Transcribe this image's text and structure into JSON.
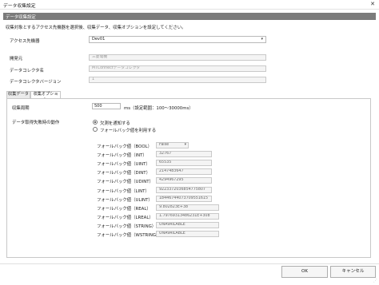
{
  "window": {
    "title": "データ収集設定",
    "close_glyph": "✕"
  },
  "header": {
    "title": "データ収集設定"
  },
  "description": "収集対象とするアクセス先機器を選択後、収集データ、収集オプションを設定してください。",
  "access": {
    "device_label": "アクセス先機器",
    "device_value": "Dev01",
    "vendor_label": "開発元",
    "vendor_value": "三菱電機",
    "collector_label": "データコレクタ名",
    "collector_value": "MTConnectデータコレクタ",
    "version_label": "データコレクタバージョン",
    "version_value": "1"
  },
  "tabs": [
    {
      "label": "収集データ",
      "active": false
    },
    {
      "label": "収集オプション",
      "active": true
    }
  ],
  "options": {
    "cycle_label": "収集周期",
    "cycle_value": "500",
    "cycle_unit": "ms（設定範囲：100～30000ms）",
    "failure_label": "データ取得失敗時の動作",
    "radio_notify": "欠測を通知する",
    "radio_fallback": "フォールバック値を利用する",
    "radio_selected": "notify",
    "fallback_rows": [
      {
        "label": "フォールバック値（BOOL）",
        "value": "False"
      },
      {
        "label": "フォールバック値（INT）",
        "value": "32767"
      },
      {
        "label": "フォールバック値（UINT）",
        "value": "65535"
      },
      {
        "label": "フォールバック値（DINT）",
        "value": "2147483647"
      },
      {
        "label": "フォールバック値（UDINT）",
        "value": "4294967295"
      },
      {
        "label": "フォールバック値（LINT）",
        "value": "9223372036854775807"
      },
      {
        "label": "フォールバック値（ULINT）",
        "value": "18446744073709551615"
      },
      {
        "label": "フォールバック値（REAL）",
        "value": "9.802823E+38"
      },
      {
        "label": "フォールバック値（LREAL）",
        "value": "1.79769313486231E+308"
      },
      {
        "label": "フォールバック値（STRING）",
        "value": "UNAVAILABLE"
      },
      {
        "label": "フォールバック値（WSTRING）",
        "value": "UNAVAILABLE"
      }
    ]
  },
  "footer": {
    "ok_label": "OK",
    "cancel_label": "キャンセル"
  }
}
